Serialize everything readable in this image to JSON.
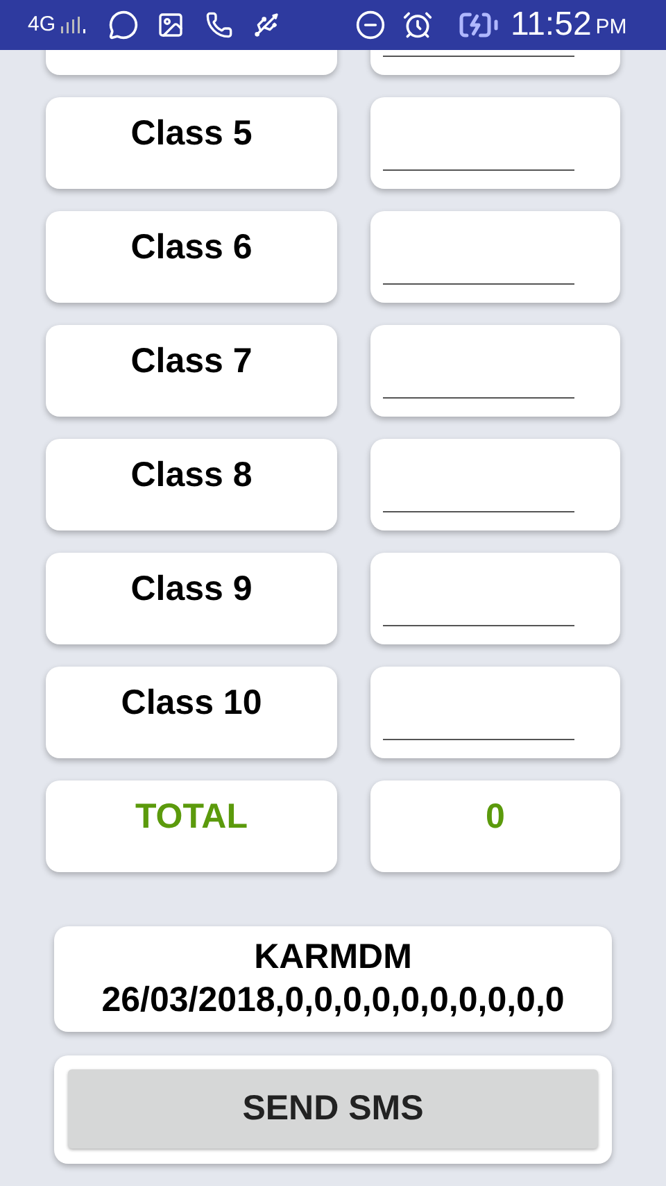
{
  "status_bar": {
    "network": "4G",
    "time": "11:52",
    "time_suffix": "PM"
  },
  "rows": [
    {
      "label": "Class 5"
    },
    {
      "label": "Class 6"
    },
    {
      "label": "Class 7"
    },
    {
      "label": "Class 8"
    },
    {
      "label": "Class 9"
    },
    {
      "label": "Class 10"
    }
  ],
  "total": {
    "label": "TOTAL",
    "value": "0"
  },
  "message": {
    "lines": [
      "KARMDM",
      "26/03/2018,0,0,0,0,0,0,0,0,0,0"
    ]
  },
  "send_button": "SEND SMS"
}
